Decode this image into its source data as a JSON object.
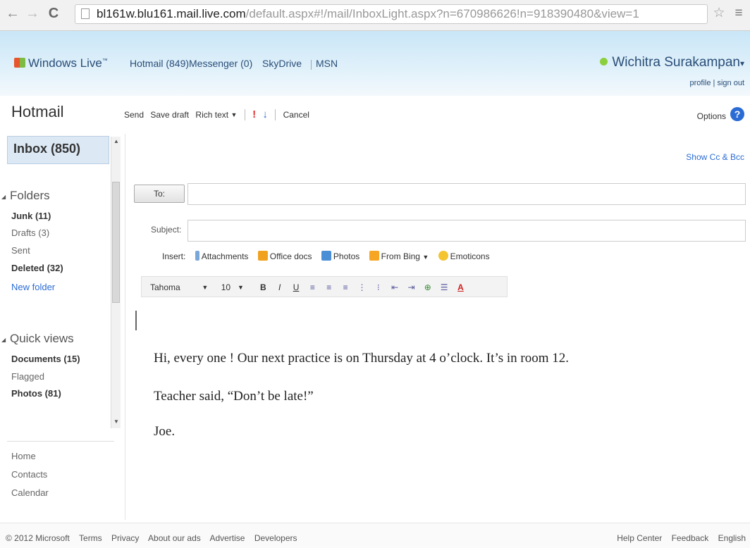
{
  "browser": {
    "url_host": "bl161w.blu161.mail.live.com",
    "url_path": "/default.aspx#!/mail/InboxLight.aspx?n=670986626!n=918390480&view=1"
  },
  "header": {
    "brand": "Windows Live",
    "trademark": "™",
    "nav": [
      "Hotmail (849)",
      "Messenger (0)",
      "SkyDrive",
      "MSN"
    ],
    "user_name": "Wichitra Surakampan",
    "profile_link": "profile",
    "signout_link": "sign out"
  },
  "toolbar": {
    "app_title": "Hotmail",
    "send": "Send",
    "save_draft": "Save draft",
    "rich_text": "Rich text",
    "cancel": "Cancel",
    "options": "Options"
  },
  "sidebar": {
    "inbox": "Inbox (850)",
    "folders_heading": "Folders",
    "folders": [
      "Junk (11)",
      "Drafts (3)",
      "Sent",
      "Deleted (32)"
    ],
    "new_folder": "New folder",
    "quick_views_heading": "Quick views",
    "quick_views": [
      "Documents (15)",
      "Flagged",
      "Photos (81)"
    ],
    "links": [
      "Home",
      "Contacts",
      "Calendar"
    ]
  },
  "compose": {
    "show_cc_bcc": "Show Cc & Bcc",
    "to_button": "To:",
    "subject_label": "Subject:",
    "insert_label": "Insert:",
    "insert_items": [
      "Attachments",
      "Office docs",
      "Photos",
      "From Bing",
      "Emoticons"
    ],
    "font_name": "Tahoma",
    "font_size": "10",
    "body_lines": [
      "Hi, every one ! Our next practice is on Thursday at  4 o’clock. It’s in room 12.",
      "Teacher said, “Don’t be late!”",
      "Joe."
    ]
  },
  "footer": {
    "left": [
      "© 2012 Microsoft",
      "Terms",
      "Privacy",
      "About our ads",
      "Advertise",
      "Developers"
    ],
    "right": [
      "Help Center",
      "Feedback",
      "English"
    ]
  }
}
